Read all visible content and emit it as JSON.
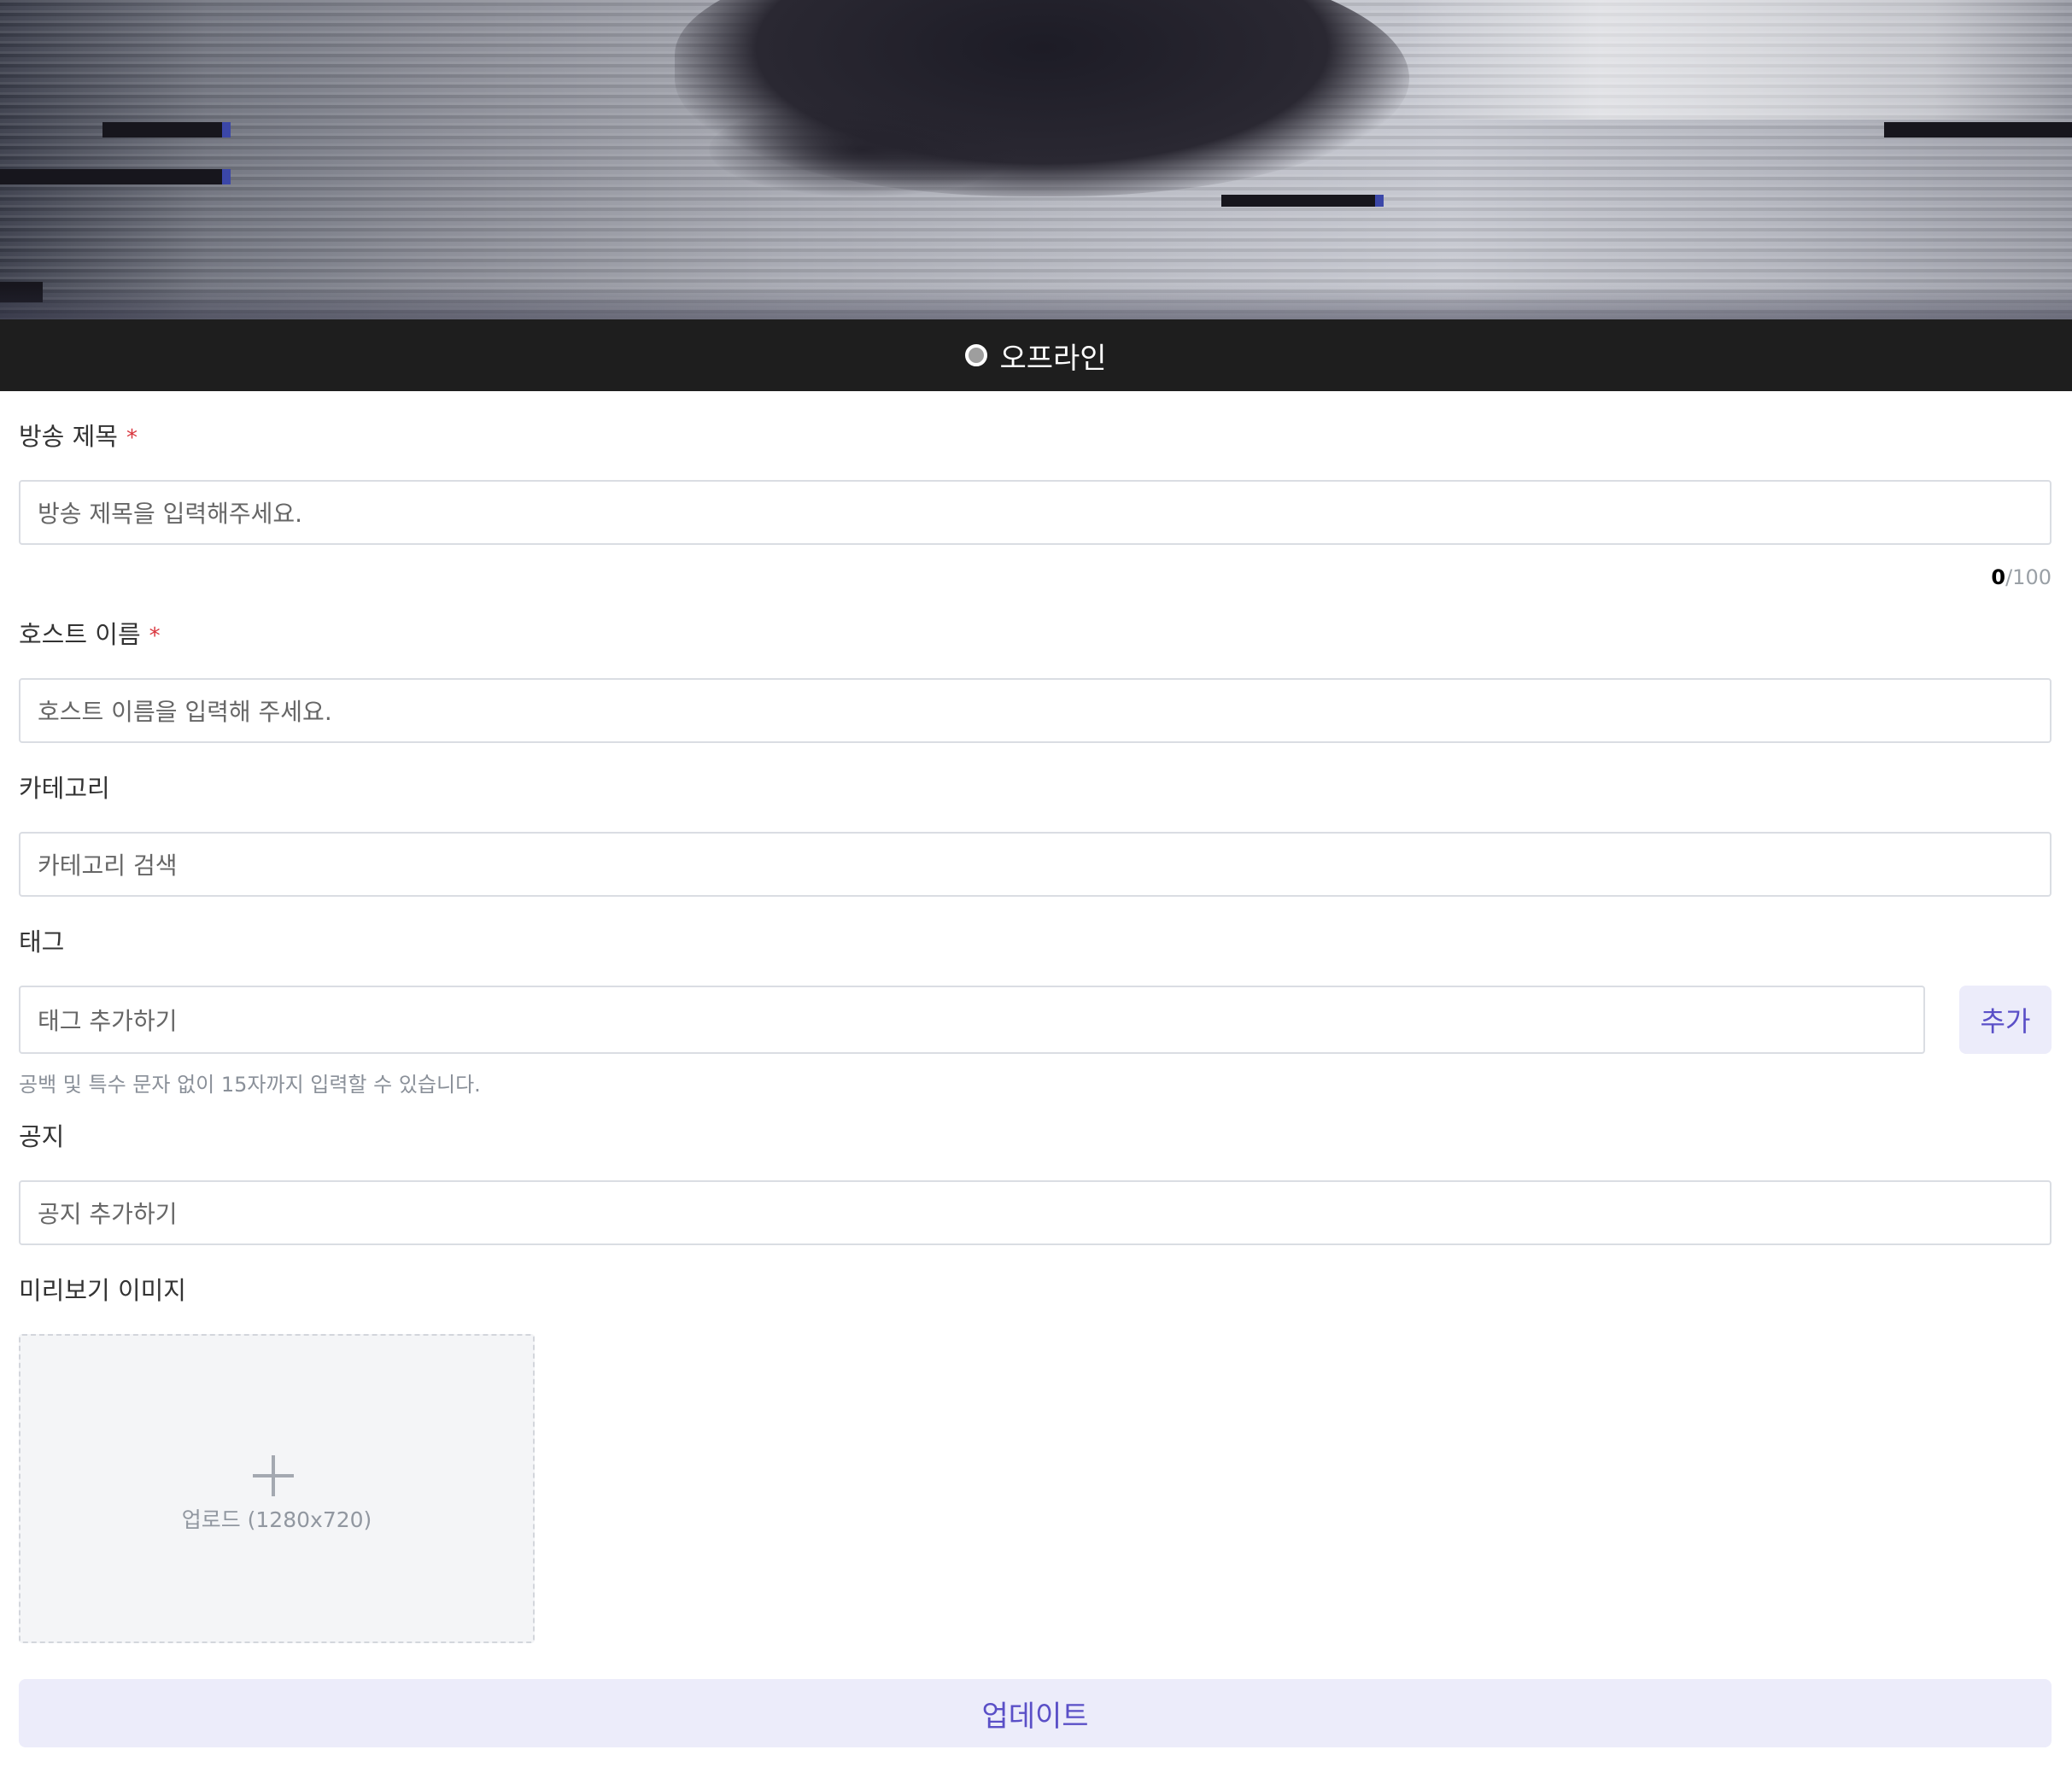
{
  "status": {
    "label": "오프라인",
    "dot_color": "#9e9e9e"
  },
  "fields": {
    "title": {
      "label": "방송 제목",
      "required_mark": "*",
      "placeholder": "방송 제목을 입력해주세요.",
      "count_current": "0",
      "count_max": "/100"
    },
    "host": {
      "label": "호스트 이름",
      "required_mark": "*",
      "placeholder": "호스트 이름을 입력해 주세요."
    },
    "category": {
      "label": "카테고리",
      "placeholder": "카테고리 검색"
    },
    "tag": {
      "label": "태그",
      "placeholder": "태그 추가하기",
      "add_button": "추가",
      "helper": "공백 및 특수 문자 없이 15자까지 입력할 수 있습니다."
    },
    "notice": {
      "label": "공지",
      "placeholder": "공지 추가하기"
    },
    "preview": {
      "label": "미리보기 이미지",
      "upload_text": "업로드 (1280x720)",
      "icon": "plus-icon"
    }
  },
  "update_button": "업데이트",
  "colors": {
    "accent": "#5a4fc7",
    "accent_bg": "#ececfa",
    "required": "#d9363e",
    "status_bar": "#1e1e1e"
  }
}
